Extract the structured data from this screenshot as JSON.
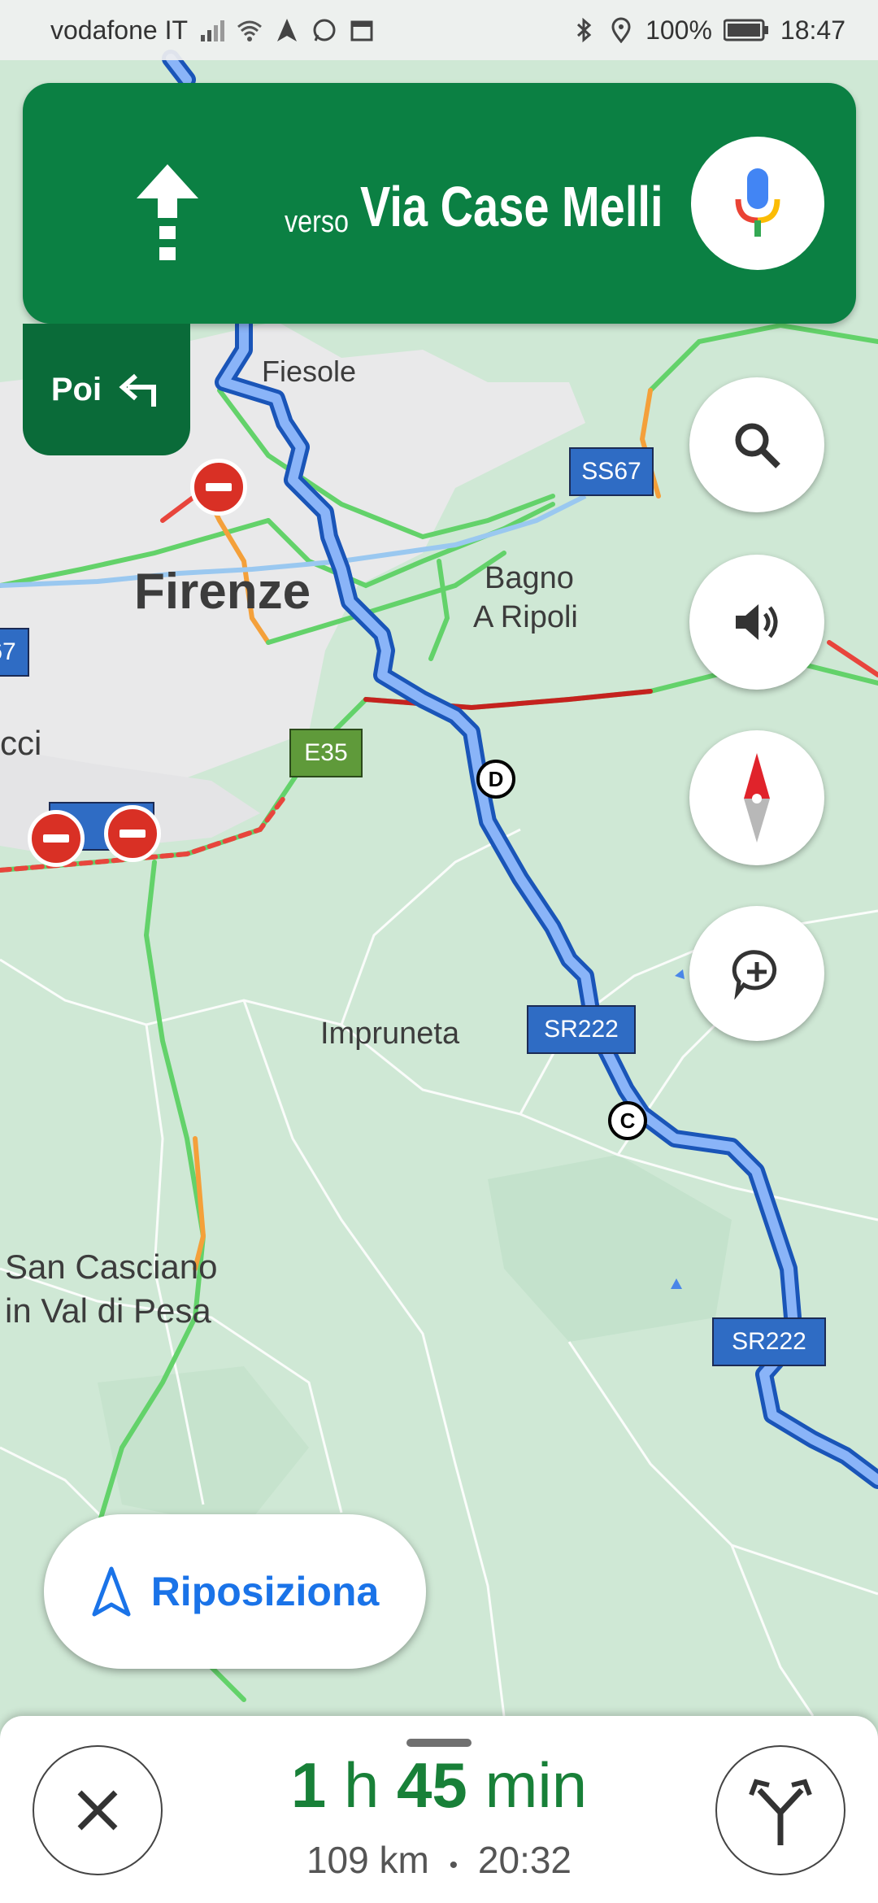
{
  "status_bar": {
    "carrier": "vodafone IT",
    "battery": "100%",
    "time": "18:47"
  },
  "navigation": {
    "direction_icon": "arrow-straight-icon",
    "toward": "verso",
    "street": "Via Case Melli",
    "voice_icon": "google-mic-icon",
    "then_label": "Poi",
    "then_icon": "turn-left-icon",
    "header_color": "#0b8043"
  },
  "map": {
    "places": [
      "Fiesole",
      "Firenze",
      "Bagno",
      "A Ripoli",
      "cci",
      "Impruneta",
      "San Casciano",
      "in Val di Pesa"
    ],
    "shields": [
      "SS67",
      "E35",
      "SR222",
      "SR222",
      "67"
    ],
    "waypoints": [
      "D",
      "C"
    ],
    "route_color": "#4a86e8"
  },
  "controls": {
    "search_icon": "search-icon",
    "sound_icon": "volume-icon",
    "compass_icon": "compass-icon",
    "report_icon": "add-report-icon"
  },
  "recenter": {
    "label": "Riposiziona",
    "icon": "navigation-arrow-icon"
  },
  "trip": {
    "hours": "1",
    "hours_unit": "h",
    "minutes": "45",
    "minutes_unit": "min",
    "distance": "109 km",
    "separator": "•",
    "arrival": "20:32",
    "eta_color": "#188038"
  }
}
